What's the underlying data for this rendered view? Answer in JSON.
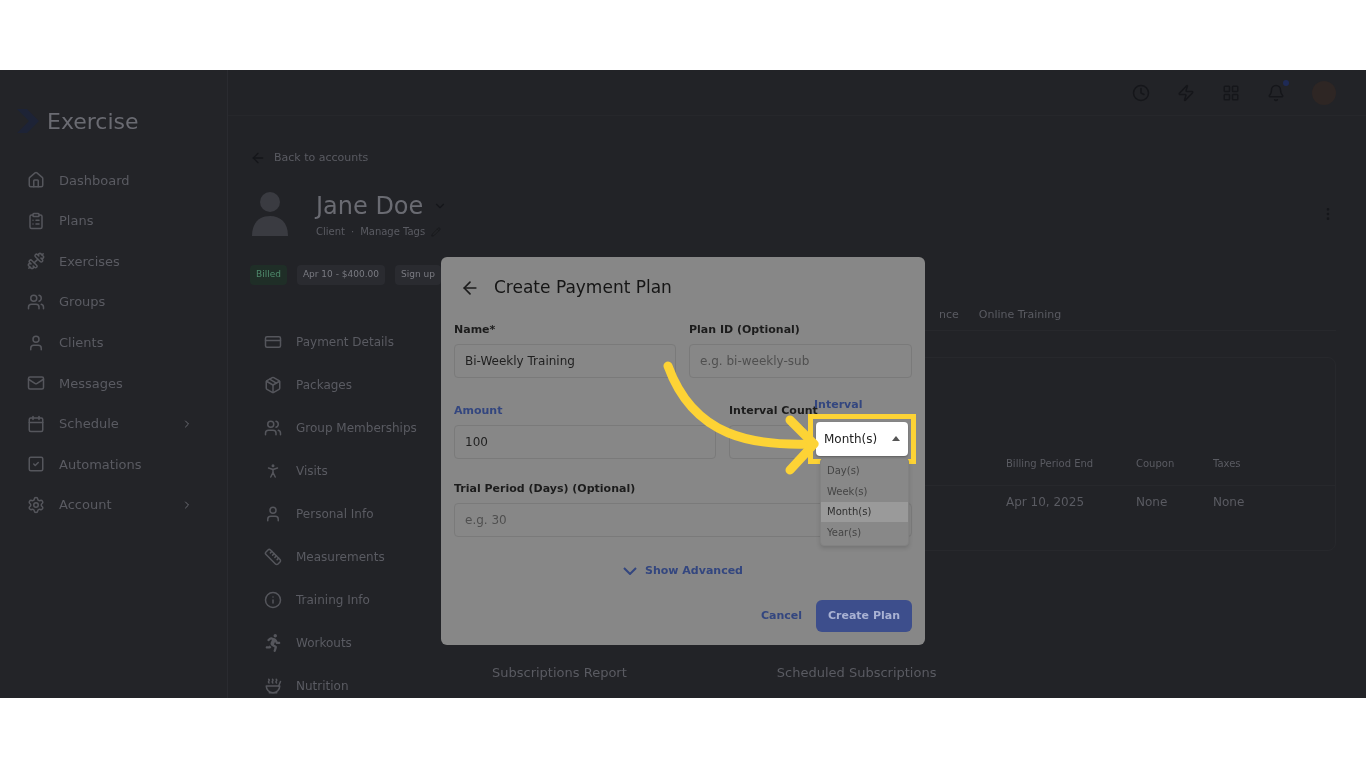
{
  "sidebar": {
    "logo_text": "Exercise",
    "items": [
      {
        "label": "Dashboard",
        "expandable": false
      },
      {
        "label": "Plans",
        "expandable": false
      },
      {
        "label": "Exercises",
        "expandable": false
      },
      {
        "label": "Groups",
        "expandable": false
      },
      {
        "label": "Clients",
        "expandable": false
      },
      {
        "label": "Messages",
        "expandable": false
      },
      {
        "label": "Schedule",
        "expandable": true
      },
      {
        "label": "Automations",
        "expandable": false
      },
      {
        "label": "Account",
        "expandable": true
      }
    ]
  },
  "top_bar": {
    "notification_dot": true
  },
  "profile": {
    "back_link": "Back to accounts",
    "name": "Jane Doe",
    "role": "Client",
    "separator": "·",
    "manage_tags": "Manage Tags"
  },
  "badges": [
    {
      "label": "Billed",
      "kind": "status"
    },
    {
      "label": "Apr 10 - $400.00",
      "kind": "plain"
    },
    {
      "label": "Sign up",
      "kind": "plain"
    }
  ],
  "profile_menu": [
    "Payment Details",
    "Packages",
    "Group Memberships",
    "Visits",
    "Personal Info",
    "Measurements",
    "Training Info",
    "Workouts",
    "Nutrition"
  ],
  "tabs": [
    "nce",
    "Online Training"
  ],
  "table": {
    "columns": [
      "Billing Period End",
      "Coupon",
      "Taxes"
    ],
    "rows": [
      [
        "Apr 10, 2025",
        "None",
        "None"
      ]
    ]
  },
  "sections": [
    "Subscriptions Report",
    "Scheduled Subscriptions"
  ],
  "modal": {
    "title": "Create Payment Plan",
    "name": {
      "label": "Name*",
      "value": "Bi-Weekly Training",
      "highlighted": false
    },
    "plan_id": {
      "label": "Plan ID (Optional)",
      "placeholder": "e.g. bi-weekly-sub",
      "highlighted": false
    },
    "amount": {
      "label": "Amount",
      "value": "100",
      "highlighted": true
    },
    "interval_count": {
      "label": "Interval Count",
      "highlighted": false
    },
    "interval": {
      "label": "Interval",
      "value": "Month(s)",
      "highlighted": true,
      "open": true,
      "options": [
        {
          "label": "Day(s)",
          "selected": false
        },
        {
          "label": "Week(s)",
          "selected": false
        },
        {
          "label": "Month(s)",
          "selected": true
        },
        {
          "label": "Year(s)",
          "selected": false
        }
      ]
    },
    "trial": {
      "label": "Trial Period (Days) (Optional)",
      "placeholder": "e.g. 30",
      "highlighted": false
    },
    "show_advanced": "Show Advanced",
    "cancel": "Cancel",
    "submit": "Create Plan"
  },
  "callout": {
    "arrow": true,
    "highlight_box": true
  }
}
